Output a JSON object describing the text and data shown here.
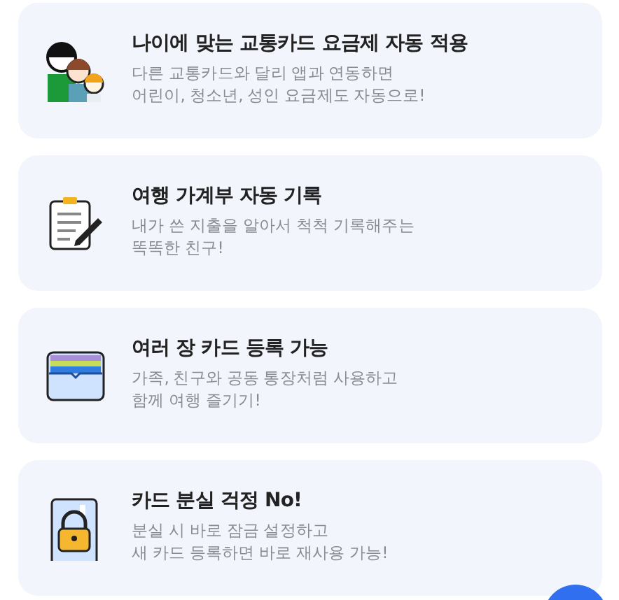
{
  "features": [
    {
      "title": "나이에 맞는 교통카드 요금제 자동 적용",
      "description": [
        "다른 교통카드와 달리 앱과 연동하면",
        "어린이, 청소년, 성인 요금제도 자동으로!"
      ]
    },
    {
      "title": "여행 가계부 자동 기록",
      "description": [
        "내가 쓴 지출을 알아서 척척 기록해주는",
        "똑똑한 친구!"
      ]
    },
    {
      "title": "여러 장 카드 등록 가능",
      "description": [
        "가족, 친구와 공동 통장처럼 사용하고",
        "함께 여행 즐기기!"
      ]
    },
    {
      "title": "카드 분실 걱정 No!",
      "description": [
        "분실 시 바로 잠금 설정하고",
        "새 카드 등록하면 바로 재사용 가능!"
      ]
    }
  ]
}
